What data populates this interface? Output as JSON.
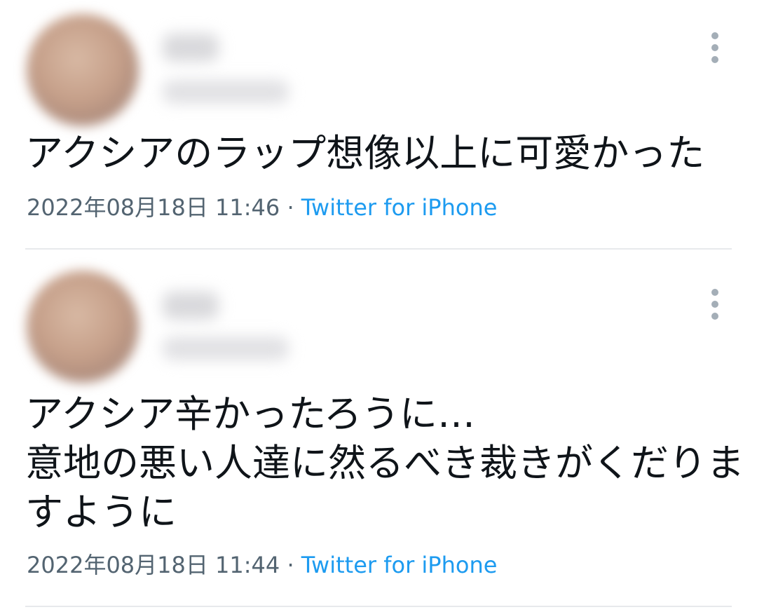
{
  "tweets": [
    {
      "text": "アクシアのラップ想像以上に可愛かった",
      "date": "2022年08月18日 11:46",
      "separator": "·",
      "source": "Twitter for iPhone",
      "more_icon": "more-vertical-icon"
    },
    {
      "text": "アクシア辛かったろうに…\n意地の悪い人達に然るべき裁きがくだりますように",
      "date": "2022年08月18日 11:44",
      "separator": "·",
      "source": "Twitter for iPhone",
      "more_icon": "more-vertical-icon"
    }
  ],
  "colors": {
    "text": "#0f1419",
    "meta": "#536471",
    "link": "#1d9bf0",
    "divider": "#e7e9ec"
  }
}
